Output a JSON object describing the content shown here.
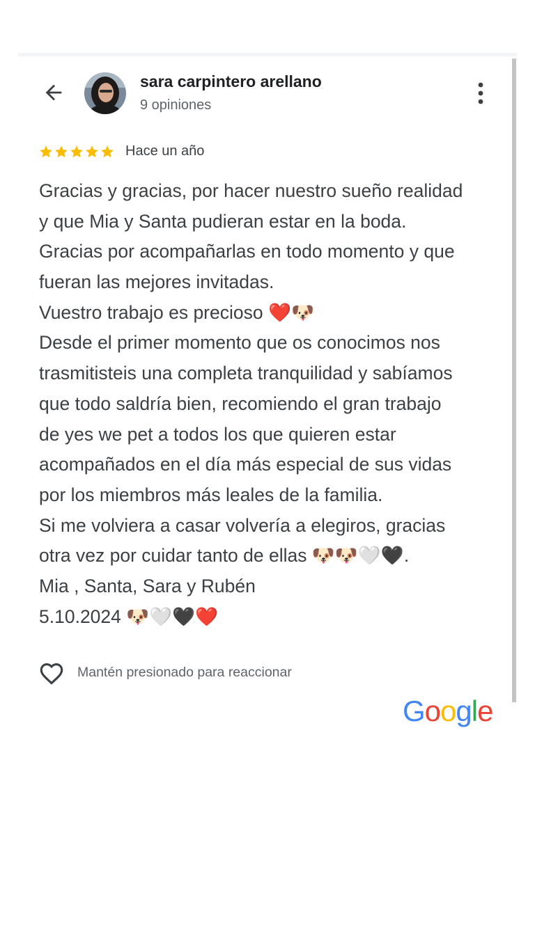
{
  "header": {
    "back_icon": "arrow-left-icon",
    "reviewer_name": "sara carpintero arellano",
    "review_count": "9 opiniones",
    "more_icon": "more-vertical-icon"
  },
  "review": {
    "rating": 5,
    "rating_max": 5,
    "star_color": "#fbbc04",
    "time_ago": "Hace un año",
    "lines": [
      "Gracias y gracias, por hacer nuestro sueño realidad",
      "y que Mia y Santa pudieran estar en la boda.",
      "Gracias por acompañarlas en todo momento y que",
      "fueran las mejores invitadas.",
      "Vuestro trabajo es precioso ❤️🐶",
      "Desde el primer momento que os conocimos nos",
      "trasmitisteis una completa tranquilidad y sabíamos",
      "que todo saldría bien, recomiendo el gran trabajo",
      "de yes we pet a todos los que quieren estar",
      "acompañados en el día más especial de sus vidas",
      "por los miembros más leales de la familia.",
      "Si me volviera a casar volvería a elegiros, gracias",
      "otra vez por cuidar tanto de ellas 🐶🐶🤍🖤.",
      "Mia , Santa, Sara y Rubén",
      "5.10.2024 🐶🤍🖤❤️"
    ]
  },
  "reaction": {
    "icon": "heart-outline-icon",
    "label": "Mantén presionado para reaccionar"
  },
  "footer": {
    "logo_letters": [
      "G",
      "o",
      "o",
      "g",
      "l",
      "e"
    ],
    "logo_colors": [
      "#4285f4",
      "#ea4335",
      "#fbbc05",
      "#4285f4",
      "#34a853",
      "#ea4335"
    ]
  }
}
